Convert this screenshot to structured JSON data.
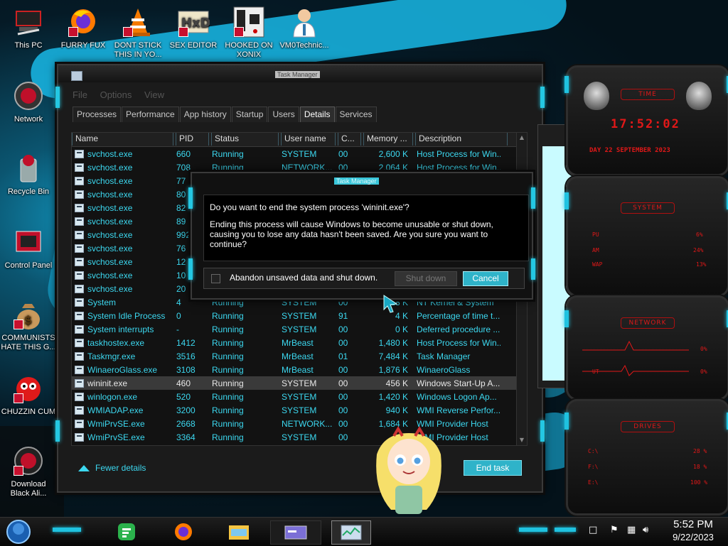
{
  "desktop": {
    "icons": [
      {
        "label": "This PC",
        "icon": "computer-icon"
      },
      {
        "label": "FURRY FUX",
        "icon": "firefox-icon"
      },
      {
        "label": "DONT STICK THIS IN YO...",
        "icon": "vlc-cone-icon"
      },
      {
        "label": "SEX EDITOR",
        "icon": "hxd-editor-icon"
      },
      {
        "label": "HOOKED ON XONIX",
        "icon": "xonix-game-icon"
      },
      {
        "label": "VM0Technic...",
        "icon": "doctor-icon"
      },
      {
        "label": "Network",
        "icon": "network-icon"
      },
      {
        "label": "Recycle Bin",
        "icon": "recycle-bin-icon"
      },
      {
        "label": "Control Panel",
        "icon": "control-panel-icon"
      },
      {
        "label": "COMMUNISTS HATE THIS G...",
        "icon": "money-bag-icon"
      },
      {
        "label": "CHUZZIN CUM",
        "icon": "chuzzle-icon"
      },
      {
        "label": "Download Black Ali...",
        "icon": "alienware-orb-icon"
      }
    ]
  },
  "task_manager": {
    "title": "Task Manager",
    "menu": [
      "File",
      "Options",
      "View"
    ],
    "tabs": [
      "Processes",
      "Performance",
      "App history",
      "Startup",
      "Users",
      "Details",
      "Services"
    ],
    "active_tab": "Details",
    "columns": [
      "Name",
      "PID",
      "Status",
      "User name",
      "C...",
      "Memory ...",
      "Description"
    ],
    "rows": [
      {
        "name": "svchost.exe",
        "pid": "660",
        "status": "Running",
        "user": "SYSTEM",
        "cpu": "00",
        "mem": "2,600 K",
        "desc": "Host Process for Win..."
      },
      {
        "name": "svchost.exe",
        "pid": "708",
        "status": "Running",
        "user": "NETWORK...",
        "cpu": "00",
        "mem": "2,064 K",
        "desc": "Host Process for Win..."
      },
      {
        "name": "svchost.exe",
        "pid": "77",
        "status": "",
        "user": "",
        "cpu": "",
        "mem": "",
        "desc": ""
      },
      {
        "name": "svchost.exe",
        "pid": "80",
        "status": "",
        "user": "",
        "cpu": "",
        "mem": "",
        "desc": ""
      },
      {
        "name": "svchost.exe",
        "pid": "82",
        "status": "",
        "user": "",
        "cpu": "",
        "mem": "",
        "desc": ""
      },
      {
        "name": "svchost.exe",
        "pid": "89",
        "status": "",
        "user": "",
        "cpu": "",
        "mem": "",
        "desc": ""
      },
      {
        "name": "svchost.exe",
        "pid": "992",
        "status": "",
        "user": "",
        "cpu": "",
        "mem": "",
        "desc": ""
      },
      {
        "name": "svchost.exe",
        "pid": "76",
        "status": "",
        "user": "",
        "cpu": "",
        "mem": "",
        "desc": ""
      },
      {
        "name": "svchost.exe",
        "pid": "12",
        "status": "",
        "user": "",
        "cpu": "",
        "mem": "",
        "desc": ""
      },
      {
        "name": "svchost.exe",
        "pid": "10",
        "status": "",
        "user": "",
        "cpu": "",
        "mem": "",
        "desc": ""
      },
      {
        "name": "svchost.exe",
        "pid": "20",
        "status": "",
        "user": "",
        "cpu": "",
        "mem": "",
        "desc": ""
      },
      {
        "name": "System",
        "pid": "4",
        "status": "Running",
        "user": "SYSTEM",
        "cpu": "00",
        "mem": "28 K",
        "desc": "NT Kernel & System"
      },
      {
        "name": "System Idle Process",
        "pid": "0",
        "status": "Running",
        "user": "SYSTEM",
        "cpu": "91",
        "mem": "4 K",
        "desc": "Percentage of time t..."
      },
      {
        "name": "System interrupts",
        "pid": "-",
        "status": "Running",
        "user": "SYSTEM",
        "cpu": "00",
        "mem": "0 K",
        "desc": "Deferred procedure ..."
      },
      {
        "name": "taskhostex.exe",
        "pid": "1412",
        "status": "Running",
        "user": "MrBeast",
        "cpu": "00",
        "mem": "1,480 K",
        "desc": "Host Process for Win..."
      },
      {
        "name": "Taskmgr.exe",
        "pid": "3516",
        "status": "Running",
        "user": "MrBeast",
        "cpu": "01",
        "mem": "7,484 K",
        "desc": "Task Manager"
      },
      {
        "name": "WinaeroGlass.exe",
        "pid": "3108",
        "status": "Running",
        "user": "MrBeast",
        "cpu": "00",
        "mem": "1,876 K",
        "desc": "WinaeroGlass"
      },
      {
        "name": "wininit.exe",
        "pid": "460",
        "status": "Running",
        "user": "SYSTEM",
        "cpu": "00",
        "mem": "456 K",
        "desc": "Windows Start-Up A..."
      },
      {
        "name": "winlogon.exe",
        "pid": "520",
        "status": "Running",
        "user": "SYSTEM",
        "cpu": "00",
        "mem": "1,420 K",
        "desc": "Windows Logon Ap..."
      },
      {
        "name": "WMIADAP.exe",
        "pid": "3200",
        "status": "Running",
        "user": "SYSTEM",
        "cpu": "00",
        "mem": "940 K",
        "desc": "WMI Reverse Perfor..."
      },
      {
        "name": "WmiPrvSE.exe",
        "pid": "2668",
        "status": "Running",
        "user": "NETWORK...",
        "cpu": "00",
        "mem": "1,684 K",
        "desc": "WMI Provider Host"
      },
      {
        "name": "WmiPrvSE.exe",
        "pid": "3364",
        "status": "Running",
        "user": "SYSTEM",
        "cpu": "00",
        "mem": "",
        "desc": "WMI Provider Host"
      }
    ],
    "selected_row_name": "wininit.exe",
    "fewer_details": "Fewer details",
    "end_task": "End task"
  },
  "dialog": {
    "title": "Task Manager",
    "question": "Do you want to end the system process 'wininit.exe'?",
    "body": "Ending this process will cause Windows to become unusable or shut down, causing you to lose any data hasn't been saved. Are you sure you want to continue?",
    "checkbox_label": "Abandon unsaved data and shut down.",
    "checkbox_checked": false,
    "shutdown_label": "Shut down",
    "cancel_label": "Cancel"
  },
  "gadgets": {
    "time": {
      "header": "TIME",
      "clock": "17:52:02",
      "date": "DAY 22 SEPTEMBER 2023"
    },
    "system": {
      "header": "SYSTEM",
      "stats": [
        {
          "label": "PU",
          "value": "6%"
        },
        {
          "label": "AM",
          "value": "24%"
        },
        {
          "label": "WAP",
          "value": "13%"
        }
      ]
    },
    "network": {
      "header": "NETWORK",
      "stats": [
        {
          "label": "",
          "value": "0%"
        },
        {
          "label": "UT",
          "value": "0%"
        }
      ]
    },
    "drives": {
      "header": "DRIVES",
      "stats": [
        {
          "label": "C:\\",
          "value": "28 %"
        },
        {
          "label": "F:\\",
          "value": "18 %"
        },
        {
          "label": "E:\\",
          "value": "100 %"
        }
      ]
    }
  },
  "taskbar": {
    "pinned": [
      "feedly-icon",
      "firefox-icon",
      "file-explorer-icon",
      "control-panel-icon",
      "task-manager-icon"
    ],
    "clock_time": "5:52 PM",
    "clock_date": "9/22/2023"
  },
  "colors": {
    "accent": "#3cd8f0",
    "gadget_red": "#e01818",
    "button_cyan": "#2fb3c9"
  }
}
